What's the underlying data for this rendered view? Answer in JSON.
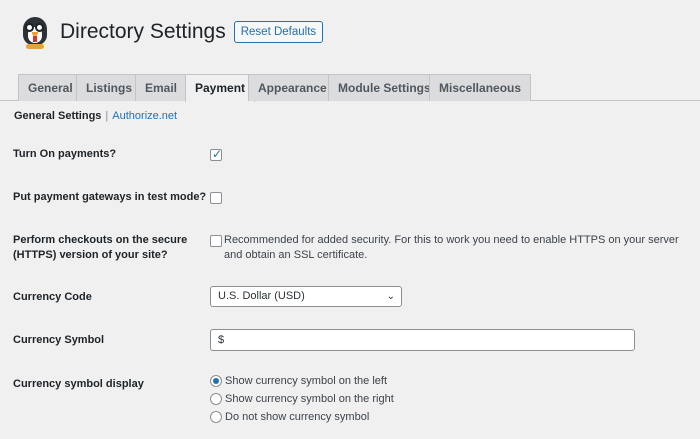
{
  "header": {
    "title": "Directory Settings",
    "reset_label": "Reset Defaults",
    "logo_icon": "penguin-mascot-icon"
  },
  "tabs": [
    {
      "label": "General",
      "active": false
    },
    {
      "label": "Listings",
      "active": false
    },
    {
      "label": "Email",
      "active": false
    },
    {
      "label": "Payment",
      "active": true
    },
    {
      "label": "Appearance",
      "active": false
    },
    {
      "label": "Module Settings",
      "active": false
    },
    {
      "label": "Miscellaneous",
      "active": false
    }
  ],
  "subnav": {
    "current": "General Settings",
    "separator": "|",
    "link": "Authorize.net"
  },
  "settings": {
    "payments_label": "Turn On payments?",
    "payments_checked": true,
    "testmode_label": "Put payment gateways in test mode?",
    "testmode_checked": false,
    "https_label_1": "Perform checkouts on the secure",
    "https_label_2": "(HTTPS) version of your site?",
    "https_checked": false,
    "https_desc": "Recommended for added security. For this to work you need to enable HTTPS on your server and obtain an SSL certificate.",
    "currency_code_label": "Currency Code",
    "currency_code_value": "U.S. Dollar (USD)",
    "currency_symbol_label": "Currency Symbol",
    "currency_symbol_value": "$",
    "symbol_display_label": "Currency symbol display",
    "symbol_display_options": [
      {
        "label": "Show currency symbol on the left",
        "selected": true
      },
      {
        "label": "Show currency symbol on the right",
        "selected": false
      },
      {
        "label": "Do not show currency symbol",
        "selected": false
      }
    ]
  },
  "colors": {
    "accent": "#2271b1",
    "background": "#f0f0f1"
  }
}
